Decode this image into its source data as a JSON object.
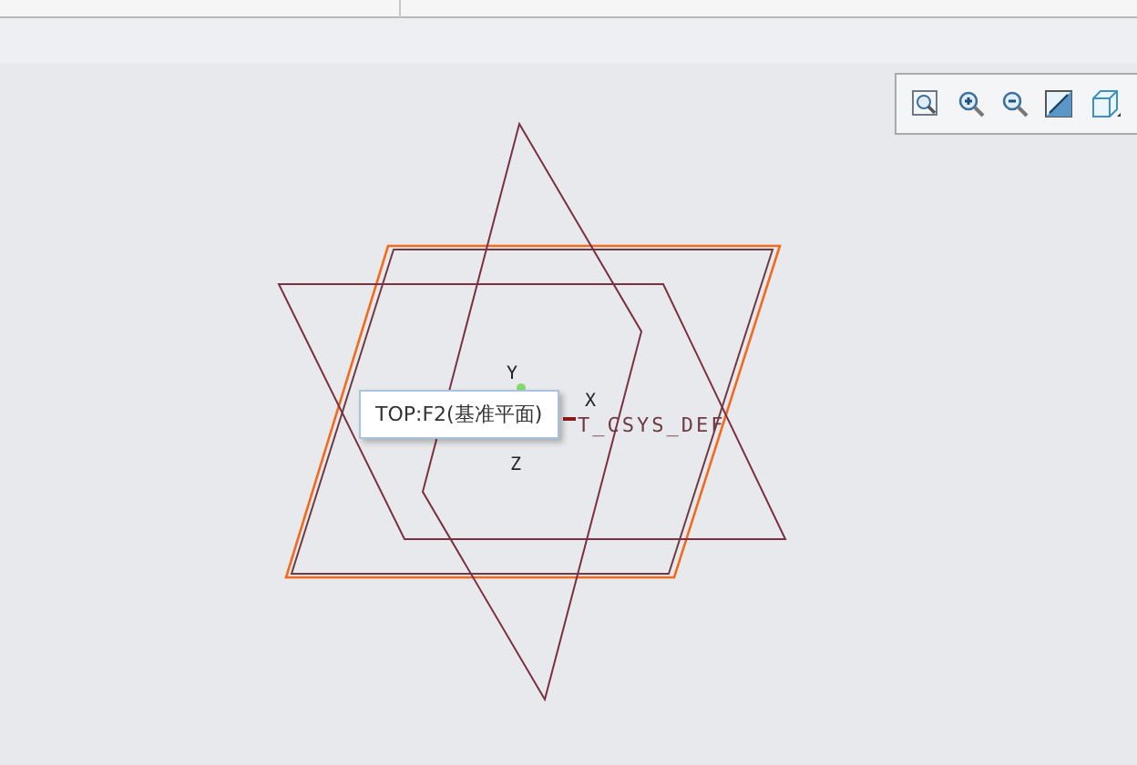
{
  "viewport": {
    "axes": [
      {
        "label": "Y"
      },
      {
        "label": "X"
      },
      {
        "label": "Z"
      }
    ],
    "csys_label": "T_CSYS_DEF"
  },
  "tooltip": {
    "text": "TOP:F2(基准平面)"
  }
}
